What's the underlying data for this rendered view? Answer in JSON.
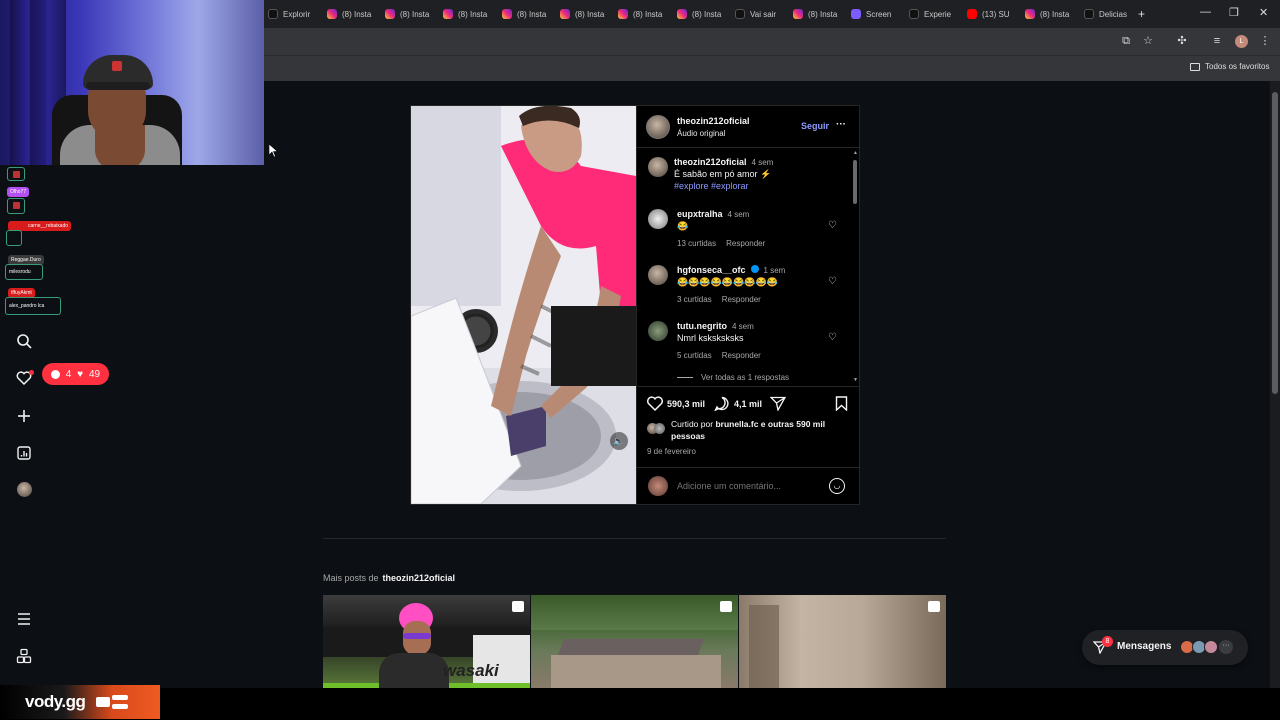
{
  "browser": {
    "tabs": [
      {
        "label": "Explorir",
        "icon": "tiktok-icon"
      },
      {
        "label": "(8) Insta",
        "icon": "instagram-icon"
      },
      {
        "label": "(8) Insta",
        "icon": "instagram-icon"
      },
      {
        "label": "(8) Insta",
        "icon": "instagram-icon"
      },
      {
        "label": "(8) Insta",
        "icon": "instagram-icon"
      },
      {
        "label": "(8) Insta",
        "icon": "instagram-icon"
      },
      {
        "label": "(8) Insta",
        "icon": "instagram-icon"
      },
      {
        "label": "(8) Insta",
        "icon": "instagram-icon"
      },
      {
        "label": "Vai sair",
        "icon": "tiktok-icon"
      },
      {
        "label": "(8) Insta",
        "icon": "instagram-icon"
      },
      {
        "label": "Screen",
        "icon": "pen-icon"
      },
      {
        "label": "Experie",
        "icon": "tiktok-icon"
      },
      {
        "label": "(13) SU",
        "icon": "youtube-icon"
      },
      {
        "label": "(8) Insta",
        "icon": "instagram-icon"
      },
      {
        "label": "Delicias",
        "icon": "tiktok-icon"
      }
    ],
    "new_tab": "+",
    "bookmarks_label": "Todos os favoritos",
    "profile_initial": "L"
  },
  "overlay": {
    "chips": [
      "Olho77",
      "carne__rebaixado",
      "Reggae.Duro",
      "milesrodu",
      "tffuyAkmt",
      "alex_pandro lca"
    ]
  },
  "nav": {
    "notifications": {
      "comments": "4",
      "likes": "49"
    }
  },
  "post": {
    "author": "theozin212oficial",
    "audio": "Áudio original",
    "follow_label": "Seguir",
    "more_label": "···",
    "caption": {
      "user": "theozin212oficial",
      "time": "4 sem",
      "text": "É sabão em pó amor ⚡",
      "tags": "#explore #explorar"
    },
    "comments": [
      {
        "user": "eupxtralha",
        "time": "4 sem",
        "text": "😂",
        "likes": "13 curtidas",
        "reply": "Responder",
        "verified": false
      },
      {
        "user": "hgfonseca__ofc",
        "time": "1 sem",
        "text": "😂😂😂😂😂😂😂😂😂",
        "likes": "3 curtidas",
        "reply": "Responder",
        "verified": true
      },
      {
        "user": "tutu.negrito",
        "time": "4 sem",
        "text": "Nmrl ksksksksks",
        "likes": "5 curtidas",
        "reply": "Responder",
        "verified": false
      }
    ],
    "view_replies": "Ver todas as 1 respostas",
    "likes_count": "590,3 mil",
    "comments_count": "4,1 mil",
    "liked_by_prefix": "Curtido por",
    "liked_by_user": "brunella.fc",
    "liked_by_mid": "e",
    "liked_by_others": "outras 590 mil pessoas",
    "date": "9 de fevereiro",
    "add_comment_placeholder": "Adicione um comentário..."
  },
  "more_posts": {
    "prefix": "Mais posts de",
    "user": "theozin212oficial",
    "thumb1_text": "wasaki"
  },
  "messages": {
    "label": "Mensagens",
    "badge": "8"
  },
  "watermark": {
    "brand": "vody.gg"
  }
}
